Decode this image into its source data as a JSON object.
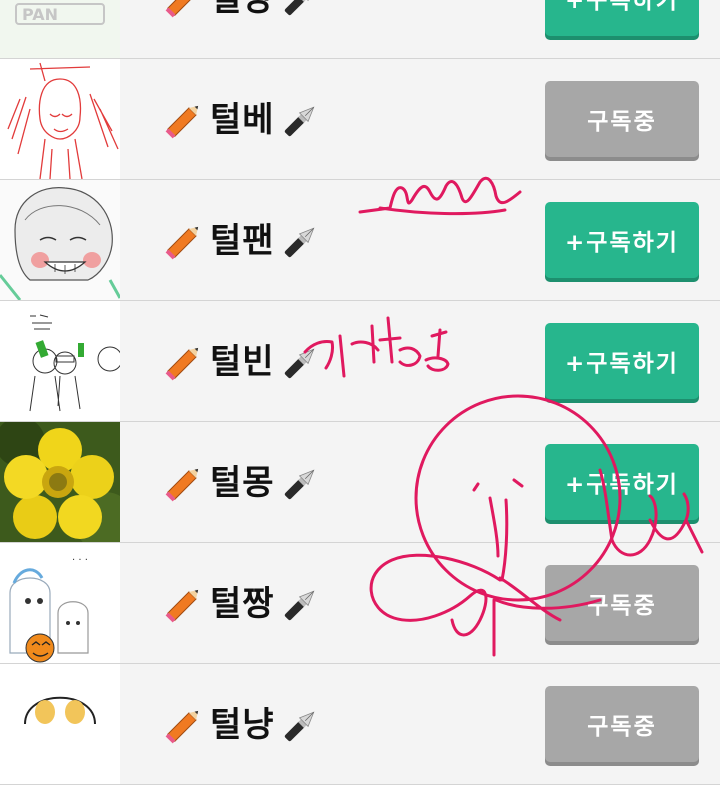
{
  "colors": {
    "subscribe_green": "#27b68d",
    "subscribed_gray": "#a7a7a7",
    "doodle_pink": "#e0195f"
  },
  "items": [
    {
      "name": "털냥",
      "thumb": "pan-logo",
      "logo_text": "PAN",
      "button": "+구독하기",
      "subscribed": false
    },
    {
      "name": "털베",
      "thumb": "red-sketch-girl",
      "button": "구독중",
      "subscribed": true
    },
    {
      "name": "털팬",
      "thumb": "smiling-face-sketch",
      "button": "+구독하기",
      "subscribed": false
    },
    {
      "name": "털빈",
      "thumb": "doodle-people",
      "button": "+구독하기",
      "subscribed": false
    },
    {
      "name": "털몽",
      "thumb": "yellow-flower-photo",
      "button": "+구독하기",
      "subscribed": false
    },
    {
      "name": "털짱",
      "thumb": "ghost-pumpkin",
      "button": "구독중",
      "subscribed": true
    },
    {
      "name": "털냥",
      "thumb": "round-face-sketch",
      "button": "구독중",
      "subscribed": true
    }
  ],
  "annotations": {
    "handwriting_2": "개만능"
  }
}
